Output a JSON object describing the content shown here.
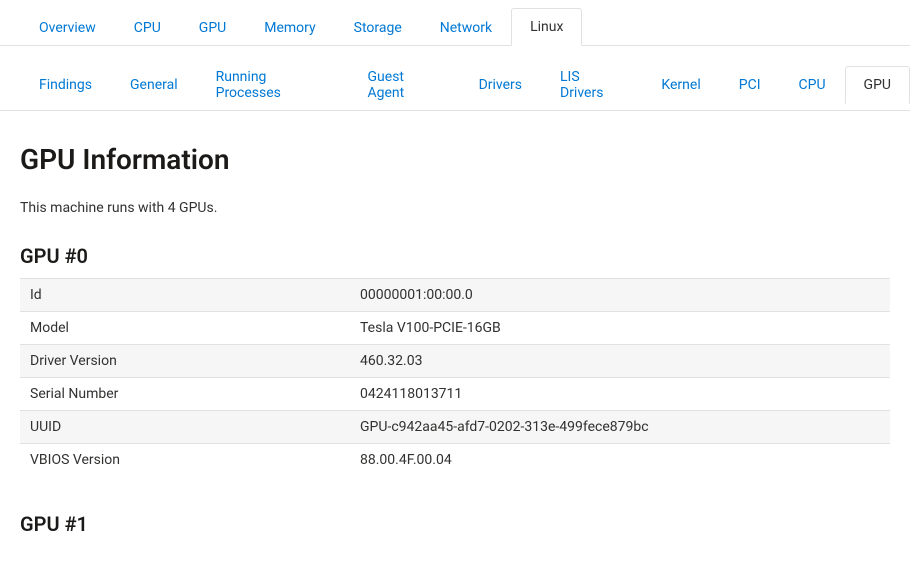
{
  "primary_tabs": [
    {
      "label": "Overview",
      "active": false
    },
    {
      "label": "CPU",
      "active": false
    },
    {
      "label": "GPU",
      "active": false
    },
    {
      "label": "Memory",
      "active": false
    },
    {
      "label": "Storage",
      "active": false
    },
    {
      "label": "Network",
      "active": false
    },
    {
      "label": "Linux",
      "active": true
    }
  ],
  "secondary_tabs": [
    {
      "label": "Findings",
      "active": false
    },
    {
      "label": "General",
      "active": false
    },
    {
      "label": "Running Processes",
      "active": false
    },
    {
      "label": "Guest Agent",
      "active": false
    },
    {
      "label": "Drivers",
      "active": false
    },
    {
      "label": "LIS Drivers",
      "active": false
    },
    {
      "label": "Kernel",
      "active": false
    },
    {
      "label": "PCI",
      "active": false
    },
    {
      "label": "CPU",
      "active": false
    },
    {
      "label": "GPU",
      "active": true
    }
  ],
  "page": {
    "title": "GPU Information",
    "description": "This machine runs with 4 GPUs."
  },
  "gpu0": {
    "title": "GPU #0",
    "rows": [
      {
        "key": "Id",
        "val": "00000001:00:00.0"
      },
      {
        "key": "Model",
        "val": "Tesla V100-PCIE-16GB"
      },
      {
        "key": "Driver Version",
        "val": "460.32.03"
      },
      {
        "key": "Serial Number",
        "val": "0424118013711"
      },
      {
        "key": "UUID",
        "val": "GPU-c942aa45-afd7-0202-313e-499fece879bc"
      },
      {
        "key": "VBIOS Version",
        "val": "88.00.4F.00.04"
      }
    ]
  },
  "gpu1": {
    "title": "GPU #1"
  }
}
